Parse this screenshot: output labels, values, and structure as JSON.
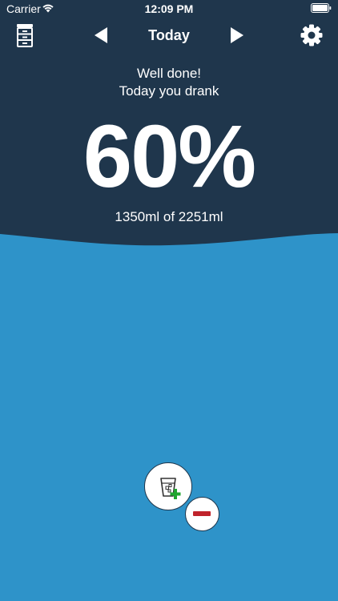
{
  "status_bar": {
    "carrier": "Carrier",
    "time": "12:09 PM"
  },
  "nav": {
    "title": "Today",
    "left_icon": "history-icon",
    "prev_icon": "triangle-left-icon",
    "next_icon": "triangle-right-icon",
    "right_icon": "gear-icon"
  },
  "summary": {
    "message_line1": "Well done!",
    "message_line2": "Today you drank",
    "percent": "60%",
    "amount": "1350ml of 2251ml",
    "progress_fraction": 0.6
  },
  "actions": {
    "add_icon": "glass-plus-icon",
    "remove_icon": "minus-icon"
  },
  "colors": {
    "background": "#1f364c",
    "water": "#2e93c9",
    "text": "#ffffff",
    "add_accent": "#1fa52e",
    "remove_accent": "#c0232b"
  }
}
